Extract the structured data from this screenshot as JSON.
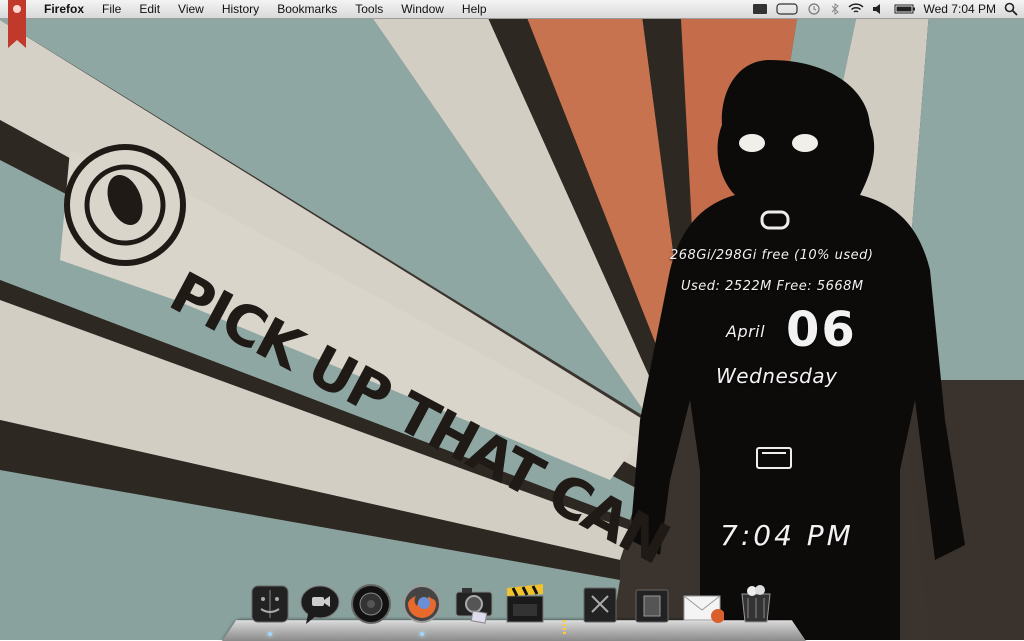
{
  "menubar": {
    "app_name": "Firefox",
    "menus": [
      "File",
      "Edit",
      "View",
      "History",
      "Bookmarks",
      "Tools",
      "Window",
      "Help"
    ],
    "clock": "Wed 7:04 PM"
  },
  "wallpaper": {
    "slogan": "PICK UP THAT CAN",
    "accent_color": "#c8734f",
    "teal_color": "#8ea7a3",
    "paper_color": "#d4d0c6",
    "stripe_color": "#2e2823"
  },
  "widgets": {
    "disk": "268Gi/298Gi free (10% used)",
    "memory": "Used: 2522M Free: 5668M",
    "month": "April",
    "day": "06",
    "weekday": "Wednesday",
    "time": "7:04 PM"
  },
  "dock": {
    "items": [
      {
        "name": "finder-icon"
      },
      {
        "name": "ichat-icon"
      },
      {
        "name": "speaker-icon"
      },
      {
        "name": "firefox-icon"
      },
      {
        "name": "camera-icon"
      },
      {
        "name": "final-cut-icon"
      },
      {
        "name": "applications-folder-icon"
      },
      {
        "name": "documents-folder-icon"
      },
      {
        "name": "mail-icon"
      },
      {
        "name": "trash-icon"
      }
    ]
  }
}
